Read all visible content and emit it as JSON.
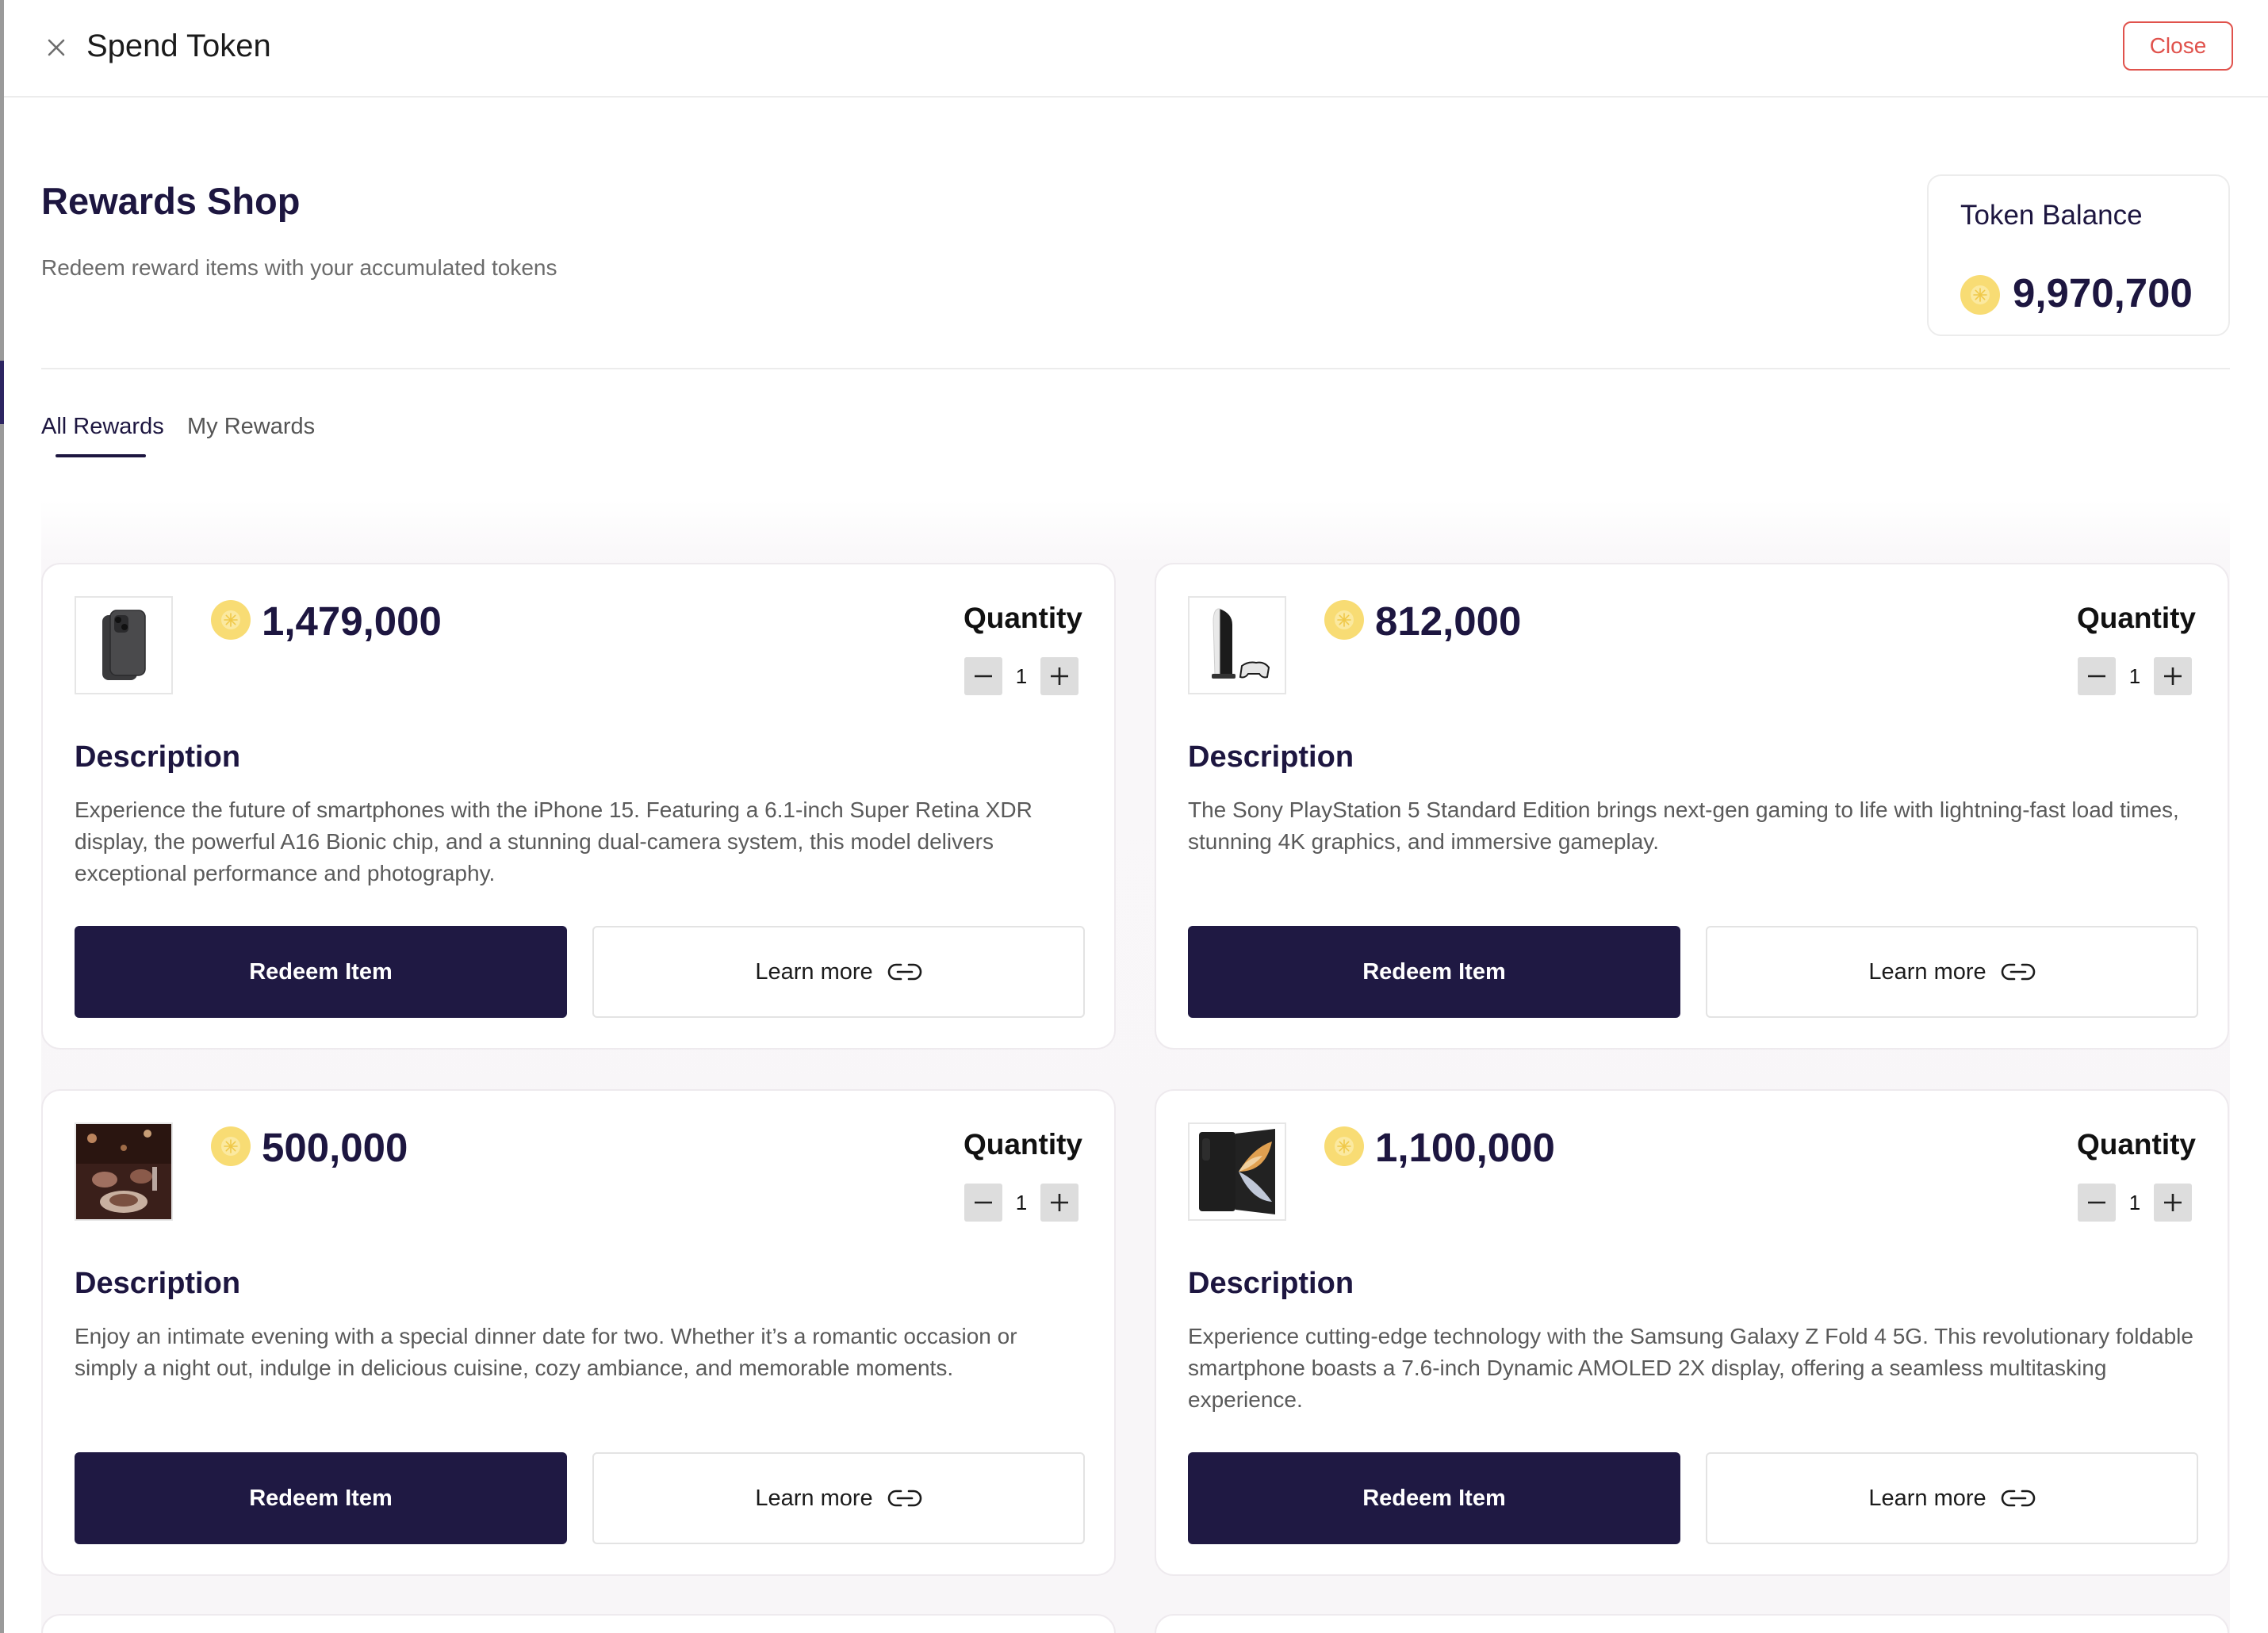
{
  "header": {
    "title": "Spend Token",
    "close_label": "Close"
  },
  "shop": {
    "title": "Rewards Shop",
    "subtitle": "Redeem reward items with your accumulated tokens"
  },
  "balance": {
    "label": "Token Balance",
    "value": "9,970,700"
  },
  "tabs": [
    {
      "label": "All Rewards",
      "active": true
    },
    {
      "label": "My Rewards",
      "active": false
    }
  ],
  "labels": {
    "quantity": "Quantity",
    "description": "Description",
    "redeem": "Redeem Item",
    "learn_more": "Learn more"
  },
  "rewards": [
    {
      "price": "1,479,000",
      "quantity": "1",
      "image_icon": "iphone-icon",
      "description": "Experience the future of smartphones with the iPhone 15. Featuring a 6.1-inch Super Retina XDR display, the powerful A16 Bionic chip, and a stunning dual-camera system, this model delivers exceptional performance and photography."
    },
    {
      "price": "812,000",
      "quantity": "1",
      "image_icon": "playstation-icon",
      "description": "The Sony PlayStation 5 Standard Edition brings next-gen gaming to life with lightning-fast load times, stunning 4K graphics, and immersive gameplay."
    },
    {
      "price": "500,000",
      "quantity": "1",
      "image_icon": "dinner-icon",
      "description": "Enjoy an intimate evening with a special dinner date for two. Whether it’s a romantic occasion or simply a night out, indulge in delicious cuisine, cozy ambiance, and memorable moments."
    },
    {
      "price": "1,100,000",
      "quantity": "1",
      "image_icon": "galaxy-fold-icon",
      "description": "Experience cutting-edge technology with the Samsung Galaxy Z Fold 4 5G. This revolutionary foldable smartphone boasts a 7.6-inch Dynamic AMOLED 2X display, offering a seamless multitasking experience."
    }
  ],
  "colors": {
    "brand": "#1f1943",
    "close_red": "#e0524c",
    "coin": "#f8dc74"
  }
}
